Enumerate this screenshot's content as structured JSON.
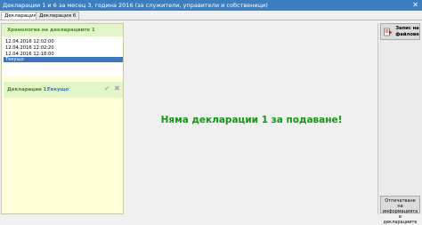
{
  "window": {
    "title": "Декларации 1 и 6 за месец 3, година 2016 (за служители, управители и собственици)",
    "close_glyph": "✕"
  },
  "tabs": [
    {
      "label": "Декларация 1",
      "active": true
    },
    {
      "label": "Декларация 6",
      "active": false
    }
  ],
  "history": {
    "header": "Хронология на декларациите 1",
    "items": [
      {
        "label": "12.04.2016 12:02:00",
        "selected": false
      },
      {
        "label": "12.04.2016 12:02:20",
        "selected": false
      },
      {
        "label": "12.04.2016 12:18:00",
        "selected": false
      },
      {
        "label": "Текущо",
        "selected": true
      }
    ]
  },
  "declaration": {
    "label": "Декларации 1:",
    "value": "Текущо",
    "confirm_icon": "check-icon",
    "delete_icon": "delete-icon"
  },
  "main": {
    "message": "Няма декларации 1 за подаване!"
  },
  "sidebar": {
    "save_button": "Запис на файлове",
    "description_button": "Отпечатване на информацията в декларациите"
  }
}
